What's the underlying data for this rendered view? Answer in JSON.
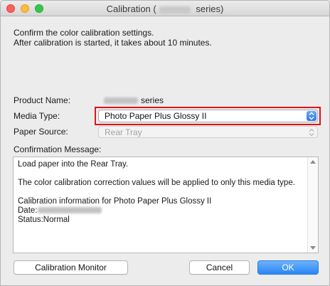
{
  "window": {
    "title_prefix": "Calibration (",
    "title_suffix": " series)"
  },
  "intro": {
    "line1": "Confirm the color calibration settings.",
    "line2": "After calibration is started, it takes about 10 minutes."
  },
  "fields": {
    "product_name_label": "Product Name:",
    "product_name_suffix": "series",
    "media_type_label": "Media Type:",
    "media_type_value": "Photo Paper Plus Glossy II",
    "paper_source_label": "Paper Source:",
    "paper_source_value": "Rear Tray"
  },
  "confirmation": {
    "label": "Confirmation Message:",
    "line1": "Load paper into the Rear Tray.",
    "line2": "The color calibration correction values will be applied to only this media type.",
    "line3": "Calibration information for Photo Paper Plus Glossy II",
    "date_label": " Date:",
    "status_line": " Status:Normal"
  },
  "buttons": {
    "monitor": "Calibration Monitor",
    "cancel": "Cancel",
    "ok": "OK"
  },
  "colors": {
    "accent": "#2a86f5",
    "highlight": "#e0121a"
  }
}
